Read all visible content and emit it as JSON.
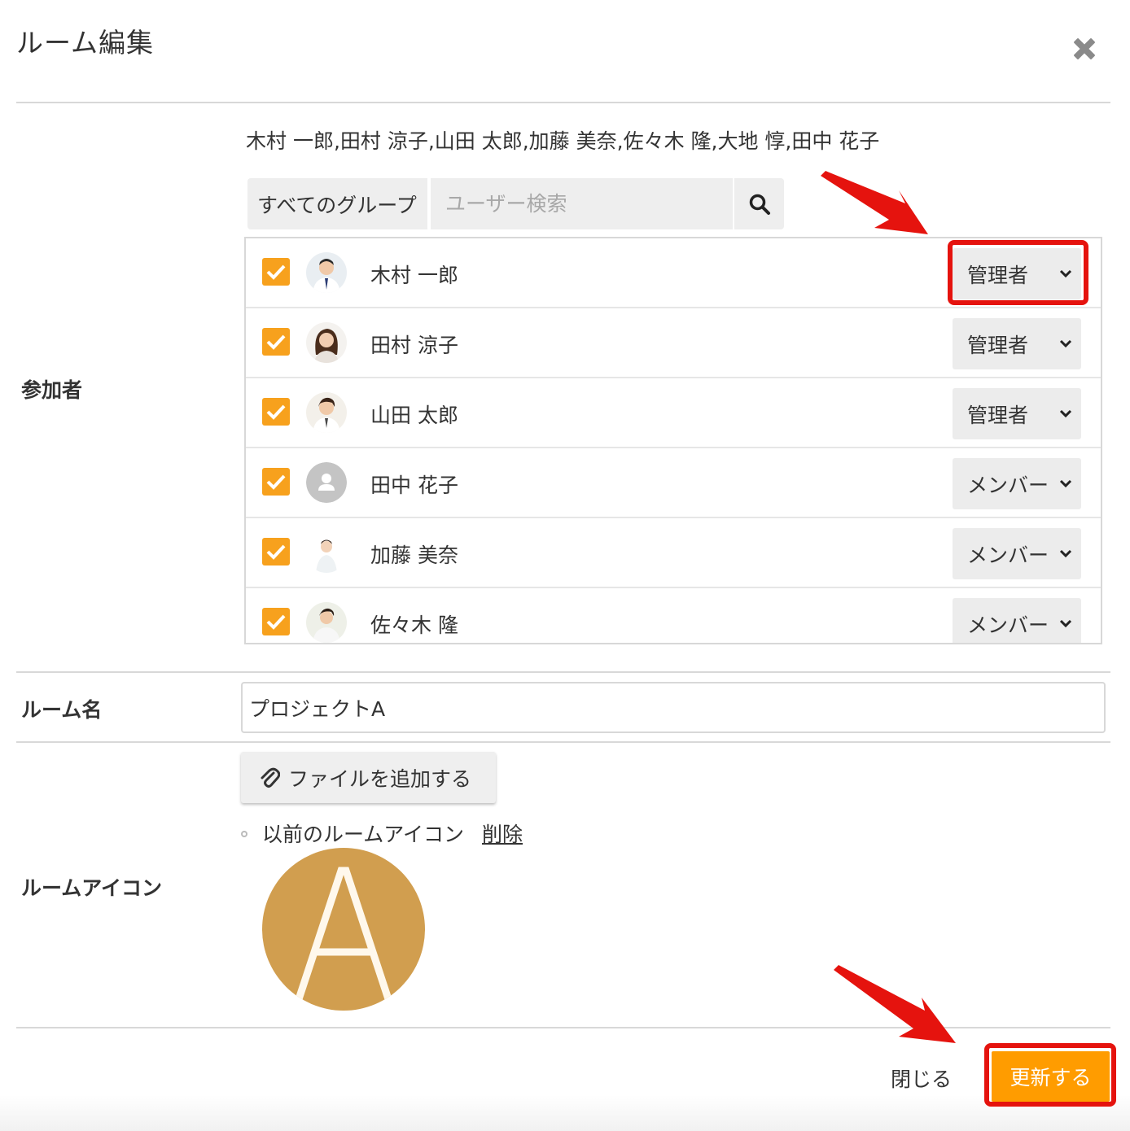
{
  "dialog": {
    "title": "ルーム編集"
  },
  "labels": {
    "participants": "参加者",
    "room_name": "ルーム名",
    "room_icon": "ルームアイコン"
  },
  "participants": {
    "summary": "木村 一郎,田村 涼子,山田 太郎,加藤 美奈,佐々木 隆,大地 惇,田中 花子",
    "group_filter": "すべてのグループ",
    "search_placeholder": "ユーザー検索",
    "members": [
      {
        "name": "木村 一郎",
        "role": "管理者",
        "checked": true
      },
      {
        "name": "田村 涼子",
        "role": "管理者",
        "checked": true
      },
      {
        "name": "山田 太郎",
        "role": "管理者",
        "checked": true
      },
      {
        "name": "田中 花子",
        "role": "メンバー",
        "checked": true
      },
      {
        "name": "加藤 美奈",
        "role": "メンバー",
        "checked": true
      },
      {
        "name": "佐々木 隆",
        "role": "メンバー",
        "checked": true
      }
    ]
  },
  "room": {
    "name_value": "プロジェクトA",
    "add_file_label": "ファイルを追加する",
    "previous_icon_label": "以前のルームアイコン",
    "delete_label": "削除",
    "icon_letter": "A",
    "icon_color": "#d19e4f"
  },
  "footer": {
    "close_label": "閉じる",
    "update_label": "更新する"
  },
  "colors": {
    "accent": "#ff9c00",
    "checkbox": "#f7a11d",
    "highlight": "#e5130e"
  }
}
